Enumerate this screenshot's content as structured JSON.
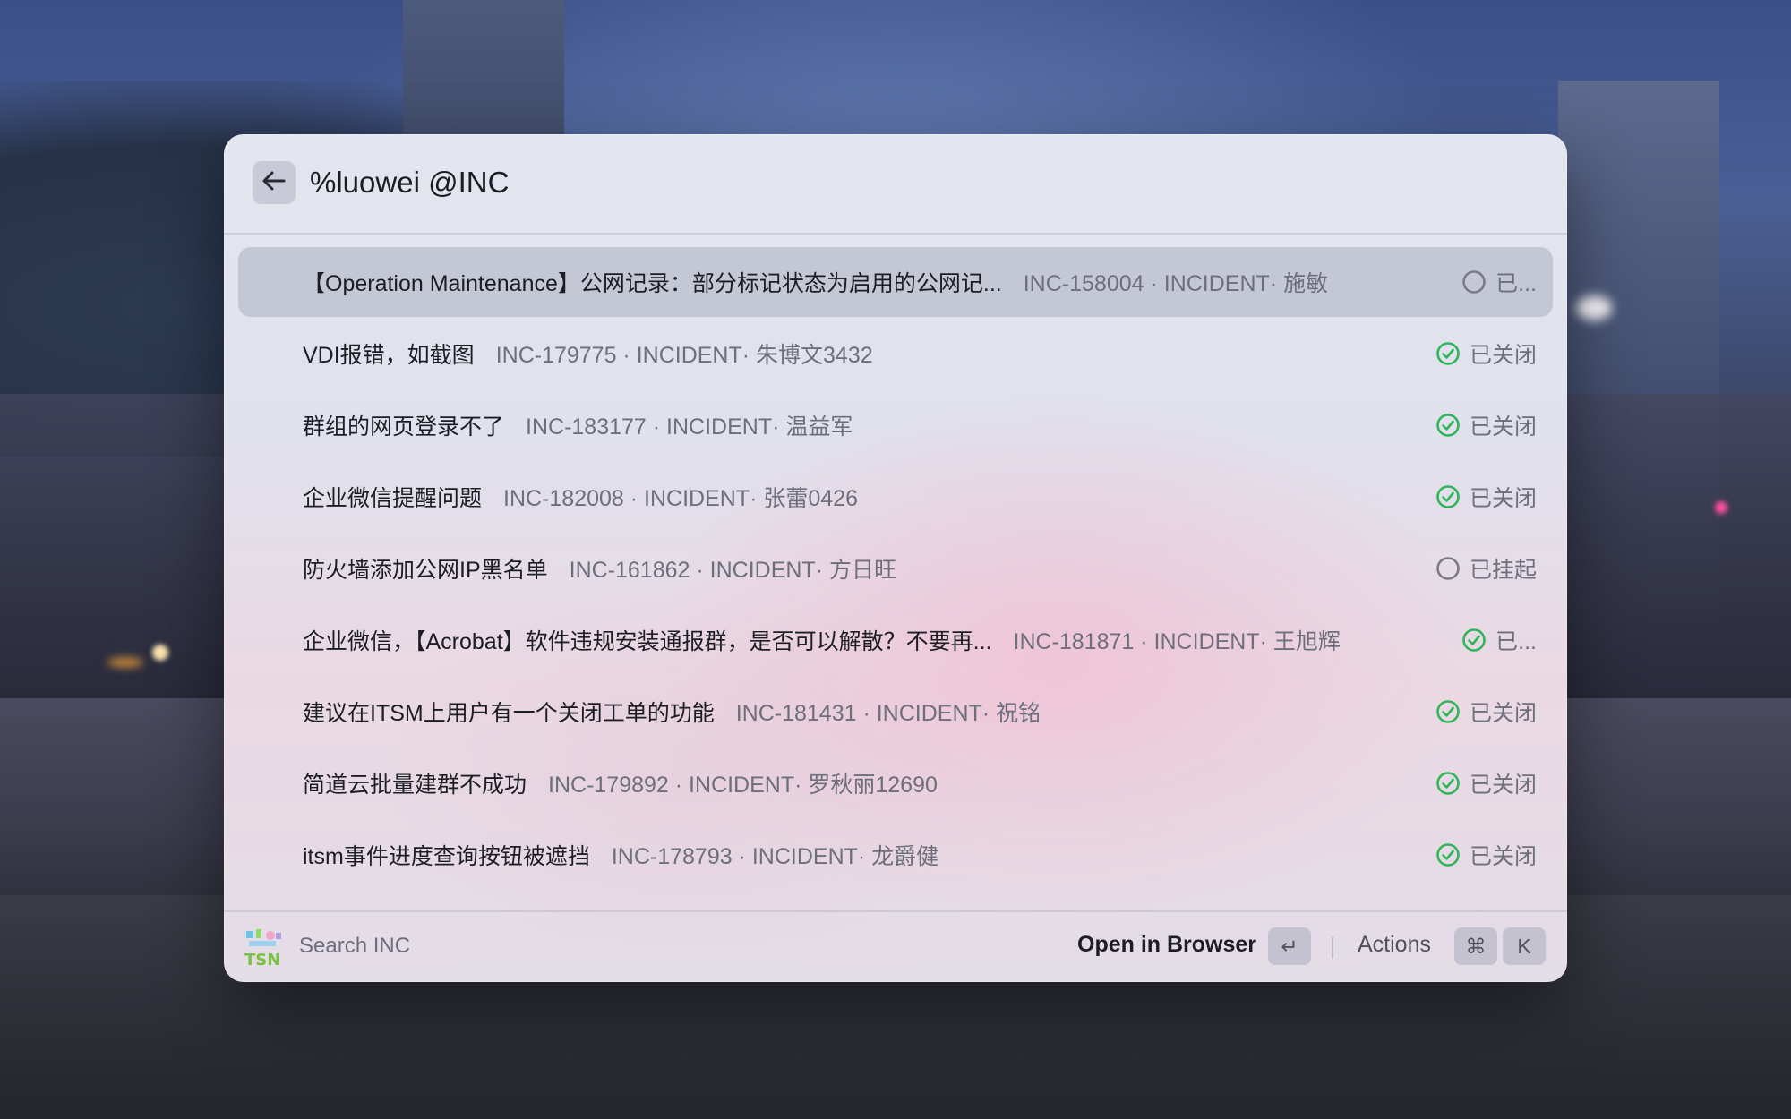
{
  "search": {
    "query": "%luowei @INC"
  },
  "results": [
    {
      "title": "【Operation Maintenance】公网记录：部分标记状态为启用的公网记...",
      "subtitle": "INC-158004 · INCIDENT· 施敏",
      "status": "已...",
      "status_type": "open"
    },
    {
      "title": "VDI报错，如截图",
      "subtitle": "INC-179775 · INCIDENT· 朱博文3432",
      "status": "已关闭",
      "status_type": "closed"
    },
    {
      "title": "群组的网页登录不了",
      "subtitle": "INC-183177 · INCIDENT· 温益军",
      "status": "已关闭",
      "status_type": "closed"
    },
    {
      "title": "企业微信提醒问题",
      "subtitle": "INC-182008 · INCIDENT· 张蕾0426",
      "status": "已关闭",
      "status_type": "closed"
    },
    {
      "title": "防火墙添加公网IP黑名单",
      "subtitle": "INC-161862 · INCIDENT· 方日旺",
      "status": "已挂起",
      "status_type": "open"
    },
    {
      "title": "企业微信，【Acrobat】软件违规安装通报群，是否可以解散？不要再...",
      "subtitle": "INC-181871 · INCIDENT· 王旭辉",
      "status": "已...",
      "status_type": "closed"
    },
    {
      "title": "建议在ITSM上用户有一个关闭工单的功能",
      "subtitle": "INC-181431 · INCIDENT· 祝铭",
      "status": "已关闭",
      "status_type": "closed"
    },
    {
      "title": "简道云批量建群不成功",
      "subtitle": "INC-179892 · INCIDENT· 罗秋丽12690",
      "status": "已关闭",
      "status_type": "closed"
    },
    {
      "title": "itsm事件进度查询按钮被遮挡",
      "subtitle": "INC-178793 · INCIDENT· 龙爵健",
      "status": "已关闭",
      "status_type": "closed"
    }
  ],
  "footer": {
    "logo_text": "TSN",
    "label": "Search INC",
    "primary_action": "Open in Browser",
    "primary_key": "↵",
    "actions_label": "Actions",
    "actions_keys": [
      "⌘",
      "K"
    ]
  },
  "colors": {
    "closed": "#2fb45a",
    "open": "#7a7b86"
  },
  "icons": {
    "back": "arrow-left-icon",
    "closed": "check-circle-icon",
    "open": "empty-circle-icon"
  }
}
